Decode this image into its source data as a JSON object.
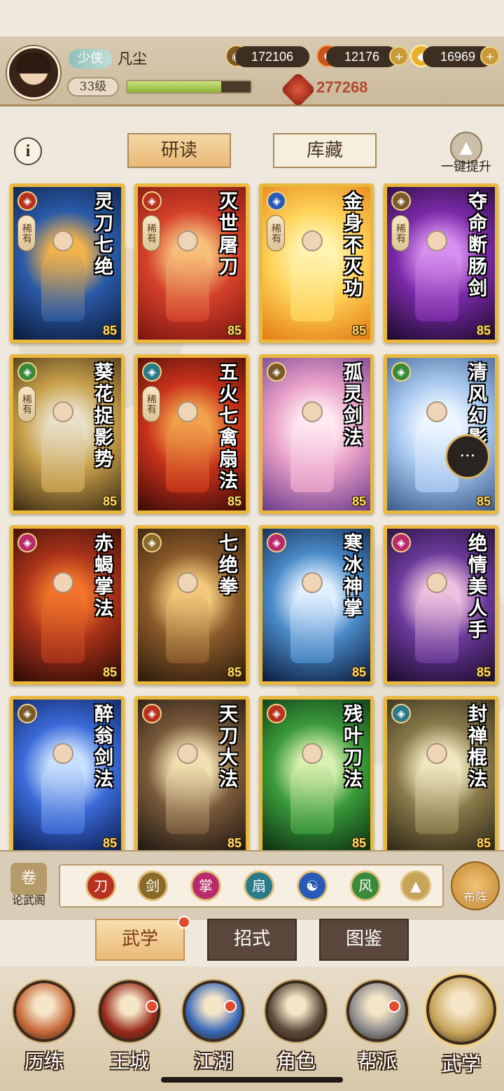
{
  "header": {
    "title_chip": "少侠",
    "player_name": "凡尘",
    "level": "33级",
    "exp_fraction": 0.76,
    "copper": "172106",
    "spirit": "12176",
    "gold": "16969",
    "power": "277268"
  },
  "tabs": {
    "study": "研读",
    "storage": "库藏",
    "info": "i",
    "upgrade_all": "一键提升"
  },
  "cards": [
    {
      "name": "灵刀七绝",
      "level": "85",
      "rare": "稀有",
      "school_icon": "blade-icon",
      "school_color": "#b8321f",
      "art": [
        "#0b1a3a",
        "#2a5aa8",
        "#f0b24a"
      ]
    },
    {
      "name": "灭世屠刀",
      "level": "85",
      "rare": "稀有",
      "school_icon": "blade-icon",
      "school_color": "#b8321f",
      "art": [
        "#7a1410",
        "#d5412a",
        "#f7c07a"
      ]
    },
    {
      "name": "金身不灭功",
      "level": "85",
      "rare": "稀有",
      "school_icon": "taiji-icon",
      "school_color": "#2a5ab8",
      "art": [
        "#e37a12",
        "#ffd45a",
        "#fff3b0"
      ]
    },
    {
      "name": "夺命断肠剑",
      "level": "85",
      "rare": "稀有",
      "school_icon": "sword-icon",
      "school_color": "#7a5a2a",
      "art": [
        "#1a0a2a",
        "#7a2aa8",
        "#d890f0"
      ]
    },
    {
      "name": "葵花捉影势",
      "level": "85",
      "rare": "稀有",
      "school_icon": "leaf-icon",
      "school_color": "#3a8a3a",
      "art": [
        "#3a2a14",
        "#c8a04a",
        "#e8e0c8"
      ]
    },
    {
      "name": "五火七禽扇法",
      "level": "85",
      "rare": "稀有",
      "school_icon": "fan-icon",
      "school_color": "#2a7a8a",
      "art": [
        "#3a0a08",
        "#c8321a",
        "#f2a04a"
      ]
    },
    {
      "name": "孤灵剑法",
      "level": "85",
      "rare": "",
      "school_icon": "sword-icon",
      "school_color": "#7a5a2a",
      "art": [
        "#6a3a8a",
        "#e8a0c8",
        "#ffe8f0"
      ]
    },
    {
      "name": "清风幻影",
      "level": "85",
      "rare": "",
      "school_icon": "leaf-icon",
      "school_color": "#3a8a3a",
      "art": [
        "#3a5a8a",
        "#a8c8f0",
        "#eef6ff"
      ]
    },
    {
      "name": "赤蝎掌法",
      "level": "85",
      "rare": "",
      "school_icon": "palm-icon",
      "school_color": "#b82a6a",
      "art": [
        "#2a0a04",
        "#a8321a",
        "#f2742a"
      ]
    },
    {
      "name": "七绝拳",
      "level": "85",
      "rare": "",
      "school_icon": "fist-icon",
      "school_color": "#8a6a2a",
      "art": [
        "#2a1a0a",
        "#8a5a2a",
        "#f2c87a"
      ]
    },
    {
      "name": "寒冰神掌",
      "level": "85",
      "rare": "",
      "school_icon": "palm-icon",
      "school_color": "#b82a6a",
      "art": [
        "#0a1a3a",
        "#4a8ac8",
        "#e0f0ff"
      ]
    },
    {
      "name": "绝情美人手",
      "level": "85",
      "rare": "",
      "school_icon": "palm-icon",
      "school_color": "#b82a6a",
      "art": [
        "#1a0a2a",
        "#6a3a9a",
        "#f0c0e0"
      ]
    },
    {
      "name": "醉翁剑法",
      "level": "85",
      "rare": "",
      "school_icon": "sword-icon",
      "school_color": "#7a5a2a",
      "art": [
        "#0a1a4a",
        "#3a6ad8",
        "#c8e0ff"
      ]
    },
    {
      "name": "天刀大法",
      "level": "85",
      "rare": "",
      "school_icon": "blade-icon",
      "school_color": "#b8321f",
      "art": [
        "#1a1410",
        "#7a5a3a",
        "#f2e0b0"
      ]
    },
    {
      "name": "残叶刀法",
      "level": "85",
      "rare": "",
      "school_icon": "blade-icon",
      "school_color": "#b8321f",
      "art": [
        "#0a2a10",
        "#3a9a3a",
        "#d8f0b0"
      ]
    },
    {
      "name": "封禅棍法",
      "level": "85",
      "rare": "",
      "school_icon": "fan-icon",
      "school_color": "#2a7a8a",
      "art": [
        "#2a2414",
        "#8a7a4a",
        "#f0e8c0"
      ]
    }
  ],
  "filter": {
    "discuss_label": "论武阁",
    "formation_label": "布阵",
    "icons": [
      {
        "name": "blade-filter-icon",
        "glyph": "刀",
        "color": "#b8321f"
      },
      {
        "name": "sword-filter-icon",
        "glyph": "剑",
        "color": "#8a6a2a"
      },
      {
        "name": "palm-filter-icon",
        "glyph": "掌",
        "color": "#b82a6a"
      },
      {
        "name": "fan-filter-icon",
        "glyph": "扇",
        "color": "#2a7a8a"
      },
      {
        "name": "taiji-filter-icon",
        "glyph": "☯",
        "color": "#2a5ab8"
      },
      {
        "name": "leaf-filter-icon",
        "glyph": "风",
        "color": "#3a8a3a"
      },
      {
        "name": "up-filter-icon",
        "glyph": "▲",
        "color": "#c8a45a"
      }
    ]
  },
  "subtabs": {
    "martial": "武学",
    "moves": "招式",
    "atlas": "图鉴"
  },
  "nav": [
    {
      "label": "历练",
      "color": "#c86a3a"
    },
    {
      "label": "王城",
      "color": "#9a2a1a"
    },
    {
      "label": "江湖",
      "color": "#3a6ab8"
    },
    {
      "label": "角色",
      "color": "#5a4a3a"
    },
    {
      "label": "帮派",
      "color": "#8a8a8a"
    },
    {
      "label": "武学",
      "color": "#c8a45a"
    }
  ]
}
